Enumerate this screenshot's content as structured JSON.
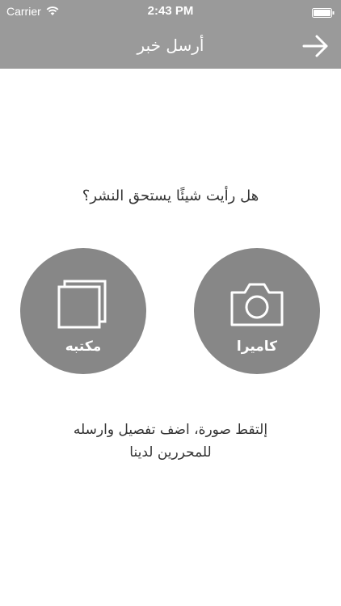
{
  "status_bar": {
    "carrier": "Carrier",
    "time": "2:43 PM"
  },
  "nav_bar": {
    "title": "أرسل خبر",
    "back_icon": "arrow-right-icon"
  },
  "main": {
    "question": "هل رأيت شيئًا يستحق النشر؟",
    "library_label": "مكتبه",
    "camera_label": "كاميرا",
    "description_line1": "إلتقط صورة، اضف تفصيل وارسله",
    "description_line2": "للمحررين لدينا"
  },
  "colors": {
    "bar": "#9a9a9a",
    "circle": "#878787",
    "text": "#333333"
  }
}
